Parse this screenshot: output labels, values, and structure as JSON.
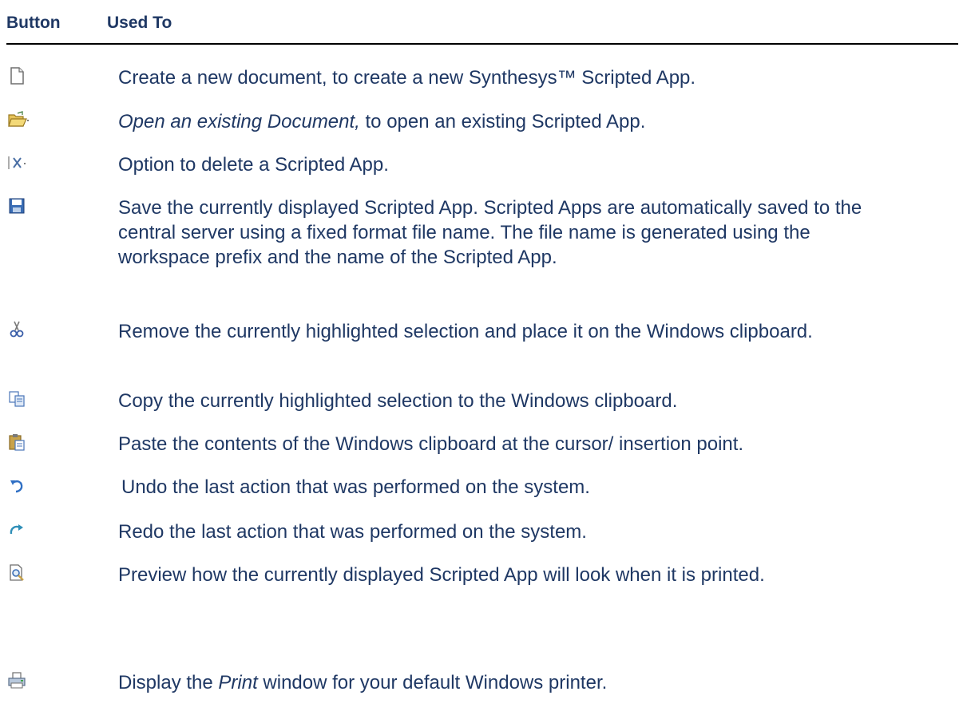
{
  "table": {
    "header": {
      "button": "Button",
      "used_to": "Used To"
    },
    "rows": [
      {
        "icon": "new-document-icon",
        "text": "Create a new document, to create a new Synthesys™ Scripted App."
      },
      {
        "icon": "open-folder-icon",
        "text_italic": "Open an existing Document,",
        "text": " to open an existing Scripted App."
      },
      {
        "icon": "delete-x-icon",
        "text": "Option to delete a Scripted App."
      },
      {
        "icon": "save-disk-icon",
        "text": "Save the currently displayed Scripted App. Scripted Apps are automatically saved to the central server using a fixed format file name. The file name is generated using the workspace prefix and the name of the Scripted App."
      },
      {
        "icon": "cut-scissors-icon",
        "text": "Remove the currently highlighted selection and place it on the Windows clipboard."
      },
      {
        "icon": "copy-icon",
        "text": "Copy the currently highlighted selection to the Windows clipboard."
      },
      {
        "icon": "paste-clipboard-icon",
        "text": "Paste the contents of the Windows clipboard at the cursor/ insertion point."
      },
      {
        "icon": "undo-icon",
        "text": "Undo the last action that was performed on the system."
      },
      {
        "icon": "redo-icon",
        "text": "Redo the last action that was performed on the system."
      },
      {
        "icon": "print-preview-icon",
        "text": "Preview how the currently displayed Scripted App will look when it is printed."
      },
      {
        "icon": "printer-icon",
        "text_before": "Display the ",
        "text_italic": "Print",
        "text": " window for your default Windows printer."
      }
    ]
  },
  "colors": {
    "text": "#1f3864",
    "rule": "#000000"
  }
}
